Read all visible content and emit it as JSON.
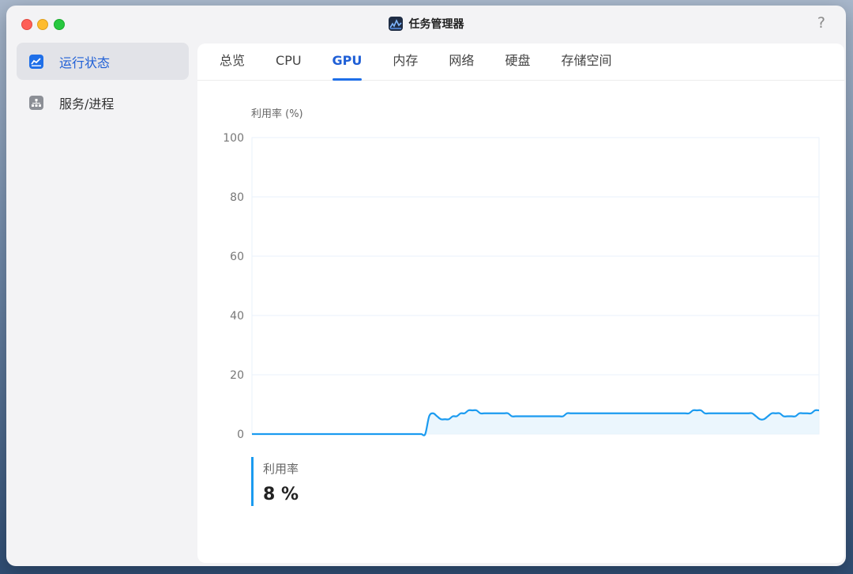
{
  "window": {
    "title": "任务管理器",
    "help": "?"
  },
  "sidebar": {
    "items": [
      {
        "label": "运行状态",
        "icon": "chart-icon",
        "active": true
      },
      {
        "label": "服务/进程",
        "icon": "sitemap-icon",
        "active": false
      }
    ]
  },
  "tabs": [
    {
      "label": "总览",
      "active": false
    },
    {
      "label": "CPU",
      "active": false
    },
    {
      "label": "GPU",
      "active": true
    },
    {
      "label": "内存",
      "active": false
    },
    {
      "label": "网络",
      "active": false
    },
    {
      "label": "硬盘",
      "active": false
    },
    {
      "label": "存储空间",
      "active": false
    }
  ],
  "colors": {
    "accent": "#1f6fe8",
    "line": "#1b9bf0",
    "fill": "#e6f4fd"
  },
  "chart_data": {
    "type": "area",
    "ylabel": "利用率 (%)",
    "ylim": [
      0,
      100
    ],
    "yticks": [
      "100",
      "80",
      "60",
      "40",
      "20",
      "0"
    ],
    "grid": true,
    "series": [
      {
        "name": "利用率",
        "values": [
          0,
          0,
          0,
          0,
          0,
          0,
          0,
          0,
          0,
          0,
          0,
          0,
          0,
          0,
          0,
          0,
          0,
          0,
          0,
          0,
          0,
          0,
          0,
          0,
          0,
          0,
          0,
          0,
          0,
          0,
          0,
          0,
          0,
          0,
          0,
          0,
          0,
          0,
          0,
          0,
          0,
          0,
          0,
          0,
          0,
          6,
          7,
          6,
          5,
          5,
          5,
          6,
          6,
          7,
          7,
          8,
          8,
          8,
          7,
          7,
          7,
          7,
          7,
          7,
          7,
          7,
          6,
          6,
          6,
          6,
          6,
          6,
          6,
          6,
          6,
          6,
          6,
          6,
          6,
          6,
          7,
          7,
          7,
          7,
          7,
          7,
          7,
          7,
          7,
          7,
          7,
          7,
          7,
          7,
          7,
          7,
          7,
          7,
          7,
          7,
          7,
          7,
          7,
          7,
          7,
          7,
          7,
          7,
          7,
          7,
          7,
          7,
          8,
          8,
          8,
          7,
          7,
          7,
          7,
          7,
          7,
          7,
          7,
          7,
          7,
          7,
          7,
          7,
          6,
          5,
          5,
          6,
          7,
          7,
          7,
          6,
          6,
          6,
          6,
          7,
          7,
          7,
          7,
          8,
          8
        ]
      }
    ]
  },
  "legend": {
    "label": "利用率",
    "value": "8 %"
  }
}
